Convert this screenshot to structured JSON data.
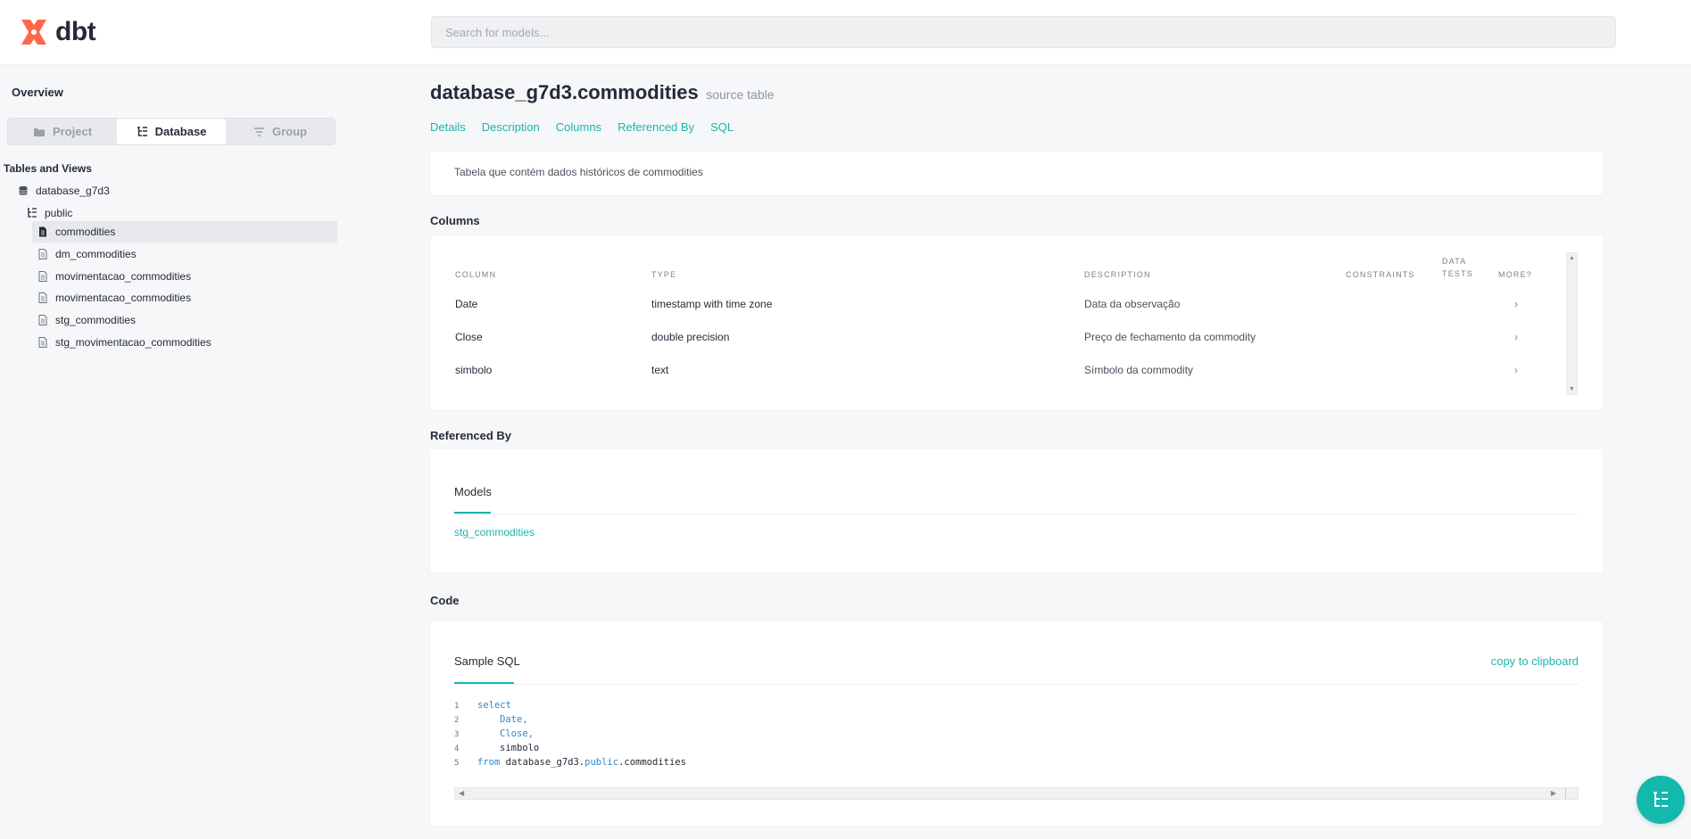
{
  "app": {
    "logo_text": "dbt",
    "brand_color": "#ff694a",
    "accent_color": "#1bb5ad"
  },
  "search": {
    "placeholder": "Search for models..."
  },
  "sidebar": {
    "overview": "Overview",
    "segments": [
      {
        "label": "Project",
        "icon": "folder-icon",
        "active": false
      },
      {
        "label": "Database",
        "icon": "tree-icon",
        "active": true
      },
      {
        "label": "Group",
        "icon": "filter-icon",
        "active": false
      }
    ],
    "tables_title": "Tables and Views",
    "database": "database_g7d3",
    "schema": "public",
    "items": [
      {
        "label": "commodities",
        "selected": true
      },
      {
        "label": "dm_commodities",
        "selected": false
      },
      {
        "label": "movimentacao_commodities",
        "selected": false
      },
      {
        "label": "movimentacao_commodities",
        "selected": false
      },
      {
        "label": "stg_commodities",
        "selected": false
      },
      {
        "label": "stg_movimentacao_commodities",
        "selected": false
      }
    ]
  },
  "main": {
    "title": "database_g7d3.commodities",
    "subtitle": "source table",
    "nav": [
      "Details",
      "Description",
      "Columns",
      "Referenced By",
      "SQL"
    ],
    "description": "Tabela que contém dados históricos de commodities",
    "columns_section": "Columns",
    "columns_headers": {
      "column": "COLUMN",
      "type": "TYPE",
      "description": "DESCRIPTION",
      "constraints": "CONSTRAINTS",
      "data_tests": "DATA TESTS",
      "more": "MORE?"
    },
    "columns": [
      {
        "column": "Date",
        "type": "timestamp with time zone",
        "description": "Data da observação"
      },
      {
        "column": "Close",
        "type": "double precision",
        "description": "Preço de fechamento da commodity"
      },
      {
        "column": "simbolo",
        "type": "text",
        "description": "Símbolo da commodity"
      }
    ],
    "referenced_section": "Referenced By",
    "referenced_tab": "Models",
    "referenced_models": [
      "stg_commodities"
    ],
    "code_section": "Code",
    "code_tab": "Sample SQL",
    "copy_label": "copy to clipboard",
    "code": {
      "line_numbers": [
        "1",
        "2",
        "3",
        "4",
        "5"
      ],
      "select_kw": "select",
      "col1": "Date,",
      "col2": "Close,",
      "col3": "simbolo",
      "from_kw": "from",
      "from_db": "database_g7d3.",
      "from_schema": "public",
      "from_table": ".commodities"
    }
  }
}
